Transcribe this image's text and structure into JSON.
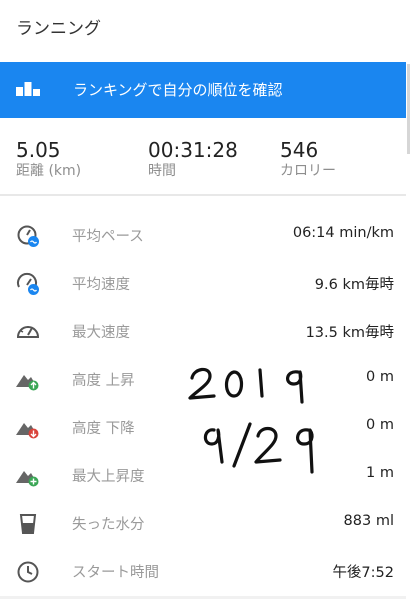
{
  "header": {
    "title": "ランニング"
  },
  "banner": {
    "label": "ランキングで自分の順位を確認",
    "color": "#1a86f0",
    "icon": "podium-icon"
  },
  "summary": [
    {
      "value": "5.05",
      "label": "距離 (km)"
    },
    {
      "value": "00:31:28",
      "label": "時間"
    },
    {
      "value": "546",
      "label": "カロリー"
    }
  ],
  "metrics": [
    {
      "icon": "pace-gauge-icon",
      "name": "平均ペース",
      "value": "06:14 min/km"
    },
    {
      "icon": "speed-gauge-icon",
      "name": "平均速度",
      "value": "9.6 km毎時"
    },
    {
      "icon": "speedometer-icon",
      "name": "最大速度",
      "value": "13.5 km毎時"
    },
    {
      "icon": "mountain-up-icon",
      "name": "高度 上昇",
      "value": "0 m"
    },
    {
      "icon": "mountain-down-icon",
      "name": "高度 下降",
      "value": "0 m"
    },
    {
      "icon": "mountain-max-icon",
      "name": "最大上昇度",
      "value": "1 m"
    },
    {
      "icon": "water-glass-icon",
      "name": "失った水分",
      "value": "883 ml"
    },
    {
      "icon": "clock-icon",
      "name": "スタート時間",
      "value": "午後7:52"
    }
  ],
  "handwriting": {
    "year": "2019",
    "date": "9/29"
  }
}
